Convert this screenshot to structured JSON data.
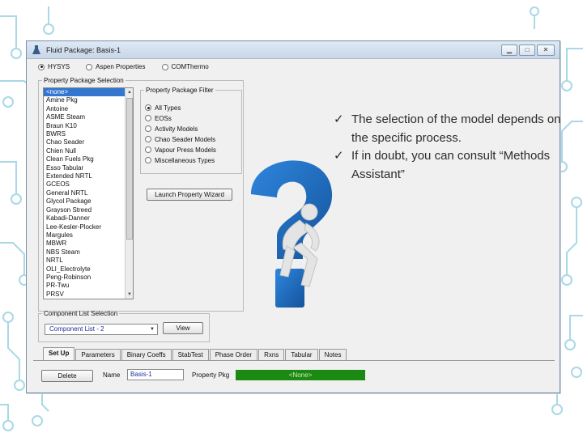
{
  "window": {
    "title": "Fluid Package: Basis-1",
    "controls": [
      "minimize",
      "maximize",
      "close"
    ]
  },
  "package_type": {
    "options": [
      "HYSYS",
      "Aspen Properties",
      "COMThermo"
    ],
    "selected": "HYSYS"
  },
  "property_package_selection": {
    "legend": "Property Package Selection",
    "items": [
      "<none>",
      "Amine Pkg",
      "Antoine",
      "ASME Steam",
      "Braun K10",
      "BWRS",
      "Chao Seader",
      "Chien Null",
      "Clean Fuels Pkg",
      "Esso Tabular",
      "Extended NRTL",
      "GCEOS",
      "General NRTL",
      "Glycol Package",
      "Grayson Streed",
      "Kabadi-Danner",
      "Lee-Kesler-Plocker",
      "Margules",
      "MBWR",
      "NBS Steam",
      "NRTL",
      "OLI_Electrolyte",
      "Peng-Robinson",
      "PR-Twu",
      "PRSV"
    ],
    "selected": "<none>"
  },
  "property_package_filter": {
    "legend": "Property Package Filter",
    "options": [
      "All Types",
      "EOSs",
      "Activity Models",
      "Chao Seader Models",
      "Vapour Press Models",
      "Miscellaneous Types"
    ],
    "selected": "All Types",
    "wizard_button": "Launch Property Wizard"
  },
  "component_list_selection": {
    "legend": "Component List Selection",
    "value": "Component List - 2",
    "view_button": "View"
  },
  "tabs": [
    "Set Up",
    "Parameters",
    "Binary Coeffs",
    "StabTest",
    "Phase Order",
    "Rxns",
    "Tabular",
    "Notes"
  ],
  "active_tab": "Set Up",
  "footer": {
    "delete_button": "Delete",
    "name_label": "Name",
    "name_value": "Basis-1",
    "property_pkg_label": "Property Pkg",
    "property_pkg_status": "<None>",
    "status_color": "#1a8a12"
  },
  "slide": {
    "bullets": [
      "The selection of the model depends on the specific process.",
      "If in doubt, you can consult “Methods Assistant”"
    ],
    "check_glyph": "✓",
    "question_mark_color": "#1f6fc4"
  }
}
